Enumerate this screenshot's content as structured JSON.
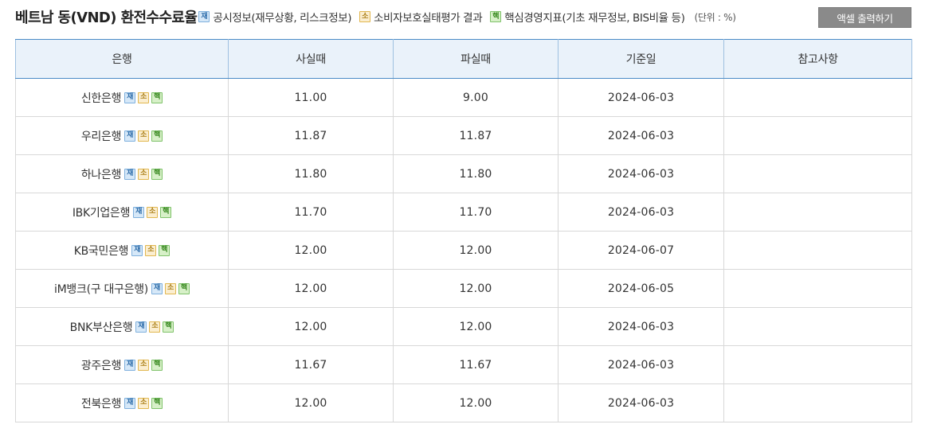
{
  "header": {
    "title": "베트남 동(VND) 환전수수료율",
    "legend": [
      {
        "badge": "재",
        "label": "공시정보(재무상황, 리스크정보)",
        "icon": "disclosure-badge-icon"
      },
      {
        "badge": "소",
        "label": "소비자보호실태평가 결과",
        "icon": "consumer-protection-badge-icon"
      },
      {
        "badge": "핵",
        "label": "핵심경영지표(기초 재무정보, BIS비율 등)",
        "icon": "key-indicator-badge-icon"
      }
    ],
    "unit": "(단위 : %)",
    "excel_button": "액셀 출력하기"
  },
  "table": {
    "columns": [
      "은행",
      "사실때",
      "파실때",
      "기준일",
      "참고사항"
    ],
    "rows": [
      {
        "bank": "신한은행",
        "buy": "11.00",
        "sell": "9.00",
        "date": "2024-06-03",
        "note": ""
      },
      {
        "bank": "우리은행",
        "buy": "11.87",
        "sell": "11.87",
        "date": "2024-06-03",
        "note": ""
      },
      {
        "bank": "하나은행",
        "buy": "11.80",
        "sell": "11.80",
        "date": "2024-06-03",
        "note": ""
      },
      {
        "bank": "IBK기업은행",
        "buy": "11.70",
        "sell": "11.70",
        "date": "2024-06-03",
        "note": ""
      },
      {
        "bank": "KB국민은행",
        "buy": "12.00",
        "sell": "12.00",
        "date": "2024-06-07",
        "note": ""
      },
      {
        "bank": "iM뱅크(구 대구은행)",
        "buy": "12.00",
        "sell": "12.00",
        "date": "2024-06-05",
        "note": ""
      },
      {
        "bank": "BNK부산은행",
        "buy": "12.00",
        "sell": "12.00",
        "date": "2024-06-03",
        "note": ""
      },
      {
        "bank": "광주은행",
        "buy": "11.67",
        "sell": "11.67",
        "date": "2024-06-03",
        "note": ""
      },
      {
        "bank": "전북은행",
        "buy": "12.00",
        "sell": "12.00",
        "date": "2024-06-03",
        "note": ""
      }
    ]
  },
  "colors": {
    "header_bg": "#eaf2fa",
    "header_border": "#4a8ac6",
    "button_bg": "#8a8a8a",
    "badge_jae": "#7fb0dd",
    "badge_so": "#e1b74f",
    "badge_haek": "#7fc26a"
  }
}
